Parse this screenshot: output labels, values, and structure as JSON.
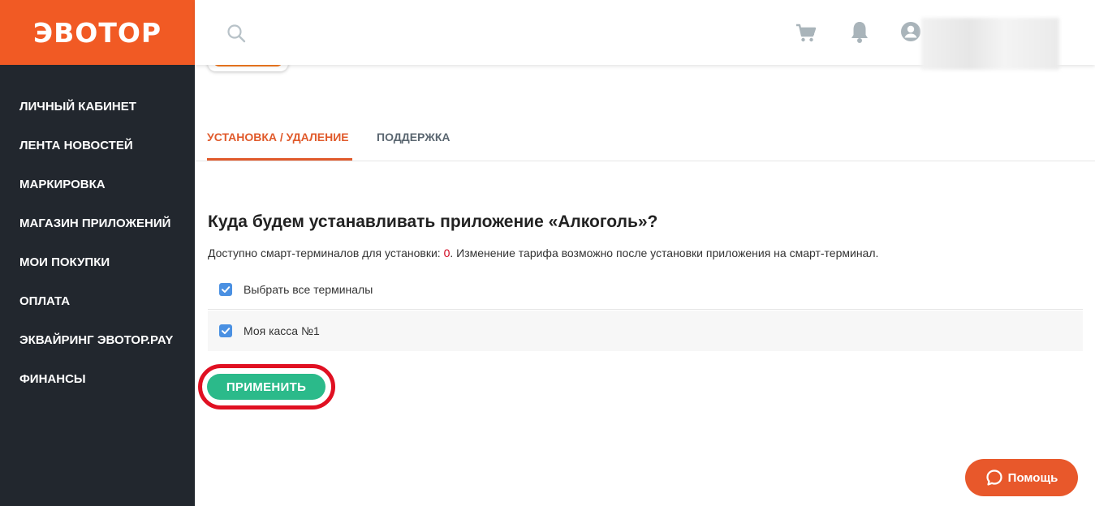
{
  "brand": {
    "logo": "ЭВОТОР",
    "accent": "#f15a24",
    "sidebar_bg": "#22272e"
  },
  "sidebar": {
    "items": [
      {
        "label": "ЛИЧНЫЙ КАБИНЕТ"
      },
      {
        "label": "ЛЕНТА НОВОСТЕЙ"
      },
      {
        "label": "МАРКИРОВКА"
      },
      {
        "label": "МАГАЗИН ПРИЛОЖЕНИЙ"
      },
      {
        "label": "МОИ ПОКУПКИ"
      },
      {
        "label": "ОПЛАТА"
      },
      {
        "label": "ЭКВАЙРИНГ ЭВОТОР.PAY"
      },
      {
        "label": "ФИНАНСЫ"
      }
    ]
  },
  "header": {
    "icons": [
      "search-icon",
      "cart-icon",
      "bell-icon",
      "user-icon"
    ]
  },
  "tabs": [
    {
      "label": "УСТАНОВКА / УДАЛЕНИЕ",
      "active": true
    },
    {
      "label": "ПОДДЕРЖКА",
      "active": false
    }
  ],
  "main": {
    "heading": "Куда будем устанавливать приложение «Алкоголь»?",
    "subtext_before": "Доступно смарт-терминалов для установки: ",
    "available_count": "0",
    "subtext_after": ". Изменение тарифа возможно после установки приложения на смарт-терминал.",
    "terminals": [
      {
        "label": "Выбрать все терминалы",
        "checked": true
      },
      {
        "label": "Моя касса №1",
        "checked": true
      }
    ],
    "apply_label": "ПРИМЕНИТЬ"
  },
  "help": {
    "label": "Помощь"
  },
  "colors": {
    "active_tab": "#e05a2b",
    "apply": "#2bba8a",
    "checkbox": "#4a90e2",
    "highlight": "#e01022",
    "help": "#e8582b"
  }
}
